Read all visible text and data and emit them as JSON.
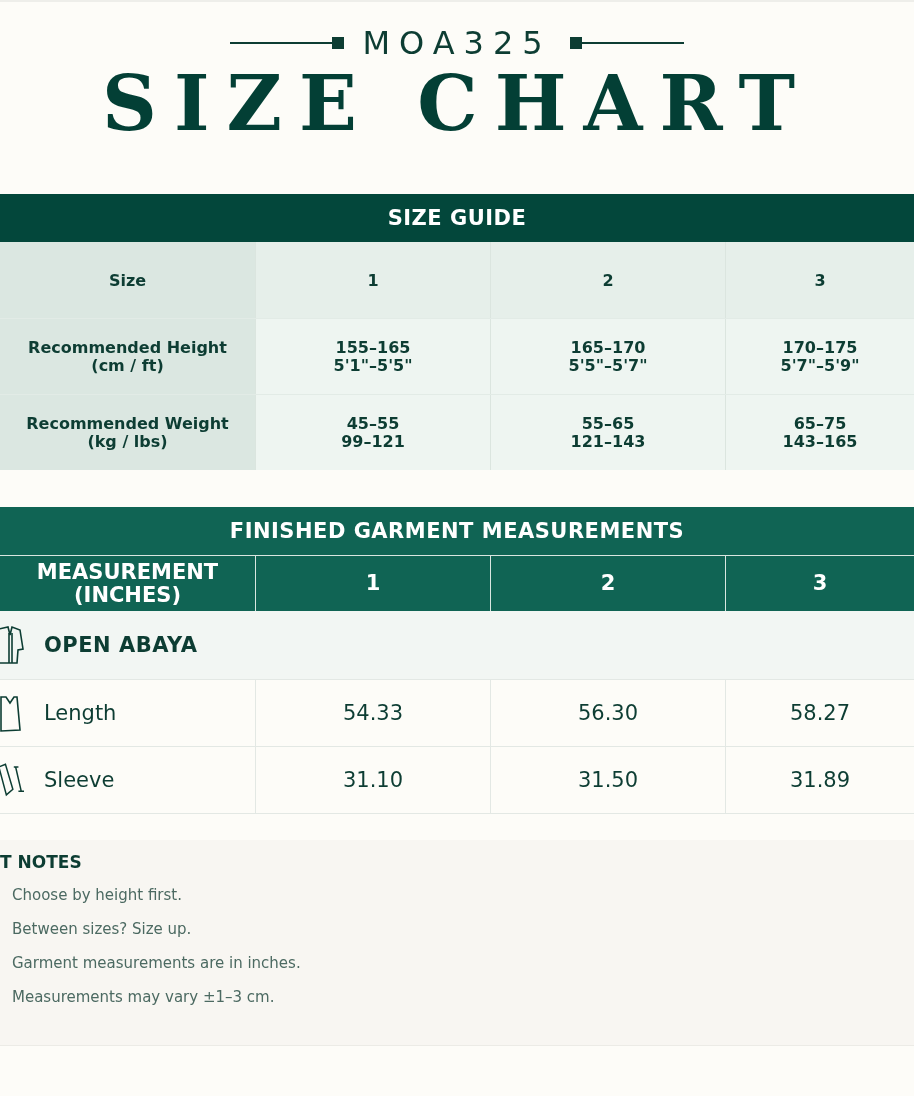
{
  "brand": "MOA325",
  "title": "SIZE CHART",
  "size_guide": {
    "title": "SIZE GUIDE",
    "columns": [
      "Size",
      "1",
      "2",
      "3"
    ],
    "rows": [
      {
        "label": "Recommended Height",
        "unit": "(cm / ft)",
        "values": [
          [
            "155–165",
            "5'1\"–5'5\""
          ],
          [
            "165–170",
            "5'5\"–5'7\""
          ],
          [
            "170–175",
            "5'7\"–5'9\""
          ]
        ]
      },
      {
        "label": "Recommended Weight",
        "unit": "(kg / lbs)",
        "values": [
          [
            "45–55",
            "99–121"
          ],
          [
            "55–65",
            "121–143"
          ],
          [
            "65–75",
            "143–165"
          ]
        ]
      }
    ]
  },
  "measurements": {
    "title": "FINISHED GARMENT MEASUREMENTS",
    "columns": [
      "MEASUREMENT (INCHES)",
      "1",
      "2",
      "3"
    ],
    "groups": [
      {
        "name": "OPEN ABAYA",
        "rows": [
          {
            "label": "Length",
            "kind": "length",
            "values": [
              "54.33",
              "56.30",
              "58.27"
            ]
          },
          {
            "label": "Sleeve",
            "kind": "sleeve",
            "values": [
              "31.10",
              "31.50",
              "31.89"
            ]
          }
        ]
      }
    ]
  },
  "notes": {
    "title": "T NOTES",
    "items": [
      "Choose by height first.",
      "Between sizes? Size up.",
      "Garment measurements are in inches.",
      "Measurements may vary ±1–3 cm."
    ]
  }
}
